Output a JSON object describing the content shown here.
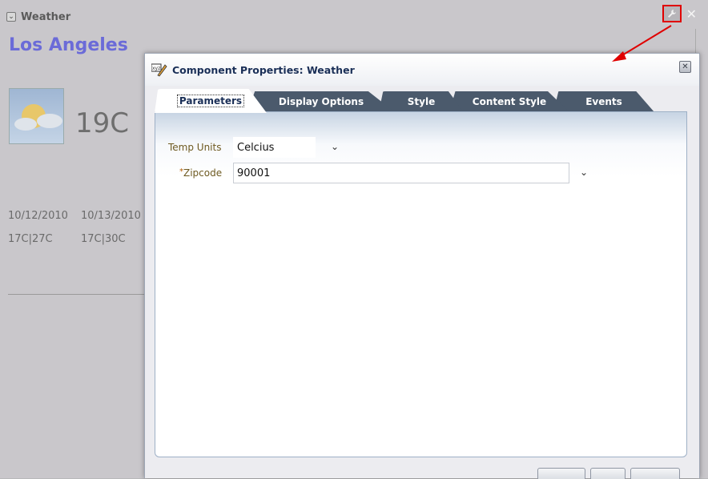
{
  "portlet": {
    "title": "Weather",
    "city": "Los Angeles",
    "current_temp": "19C",
    "forecast": {
      "dates": [
        "10/12/2010",
        "10/13/2010"
      ],
      "ranges": [
        "17C|27C",
        "17C|30C"
      ]
    },
    "icons": [
      "chevron-down-icon",
      "wrench-icon",
      "close-icon",
      "partly-sunny-icon"
    ]
  },
  "dialog": {
    "title": "Component Properties: Weather",
    "tabs": [
      {
        "label": "Parameters",
        "active": true
      },
      {
        "label": "Display Options",
        "active": false
      },
      {
        "label": "Style",
        "active": false
      },
      {
        "label": "Content Style",
        "active": false
      },
      {
        "label": "Events",
        "active": false
      }
    ],
    "fields": {
      "temp_units": {
        "label": "Temp Units",
        "value": "Celcius"
      },
      "zipcode": {
        "label": "Zipcode",
        "required_marker": "*",
        "value": "90001"
      }
    }
  },
  "colors": {
    "annotation": "#e00000",
    "tab_inactive": "#4b5a6c",
    "city": "#6b6bd8",
    "dialog_title": "#1a2f57"
  }
}
